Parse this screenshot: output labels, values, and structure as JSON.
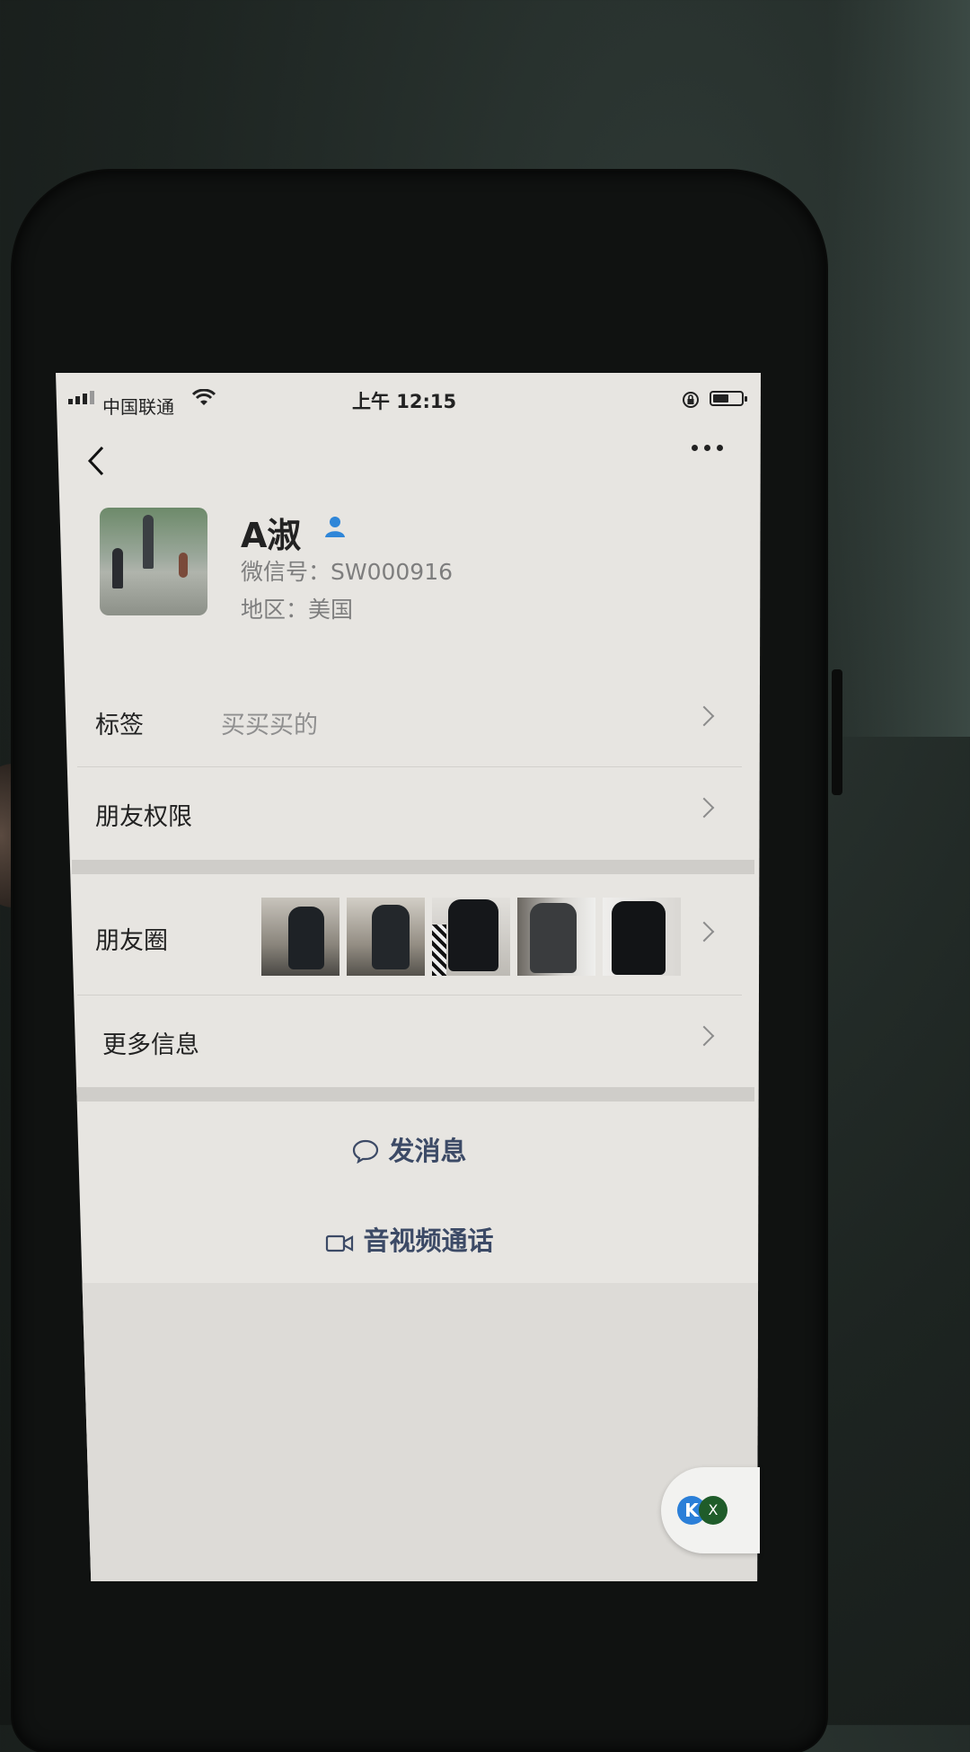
{
  "status_bar": {
    "carrier": "中国联通",
    "time": "上午 12:15",
    "battery_level": 0.55
  },
  "profile": {
    "name": "A淑",
    "wechat_id": "微信号：SW000916",
    "region": "地区：美国"
  },
  "rows": {
    "tags_label": "标签",
    "tags_value": "买买买的",
    "permissions_label": "朋友权限",
    "moments_label": "朋友圈",
    "more_info_label": "更多信息"
  },
  "actions": {
    "send_message": "发消息",
    "video_call": "音视频通话"
  },
  "floating": {
    "k_label": "K",
    "x_label": "X"
  },
  "colors": {
    "accent_icon": "#2f86d8",
    "action_text": "#3c4a66",
    "screen_bg": "#e7e5e1"
  }
}
